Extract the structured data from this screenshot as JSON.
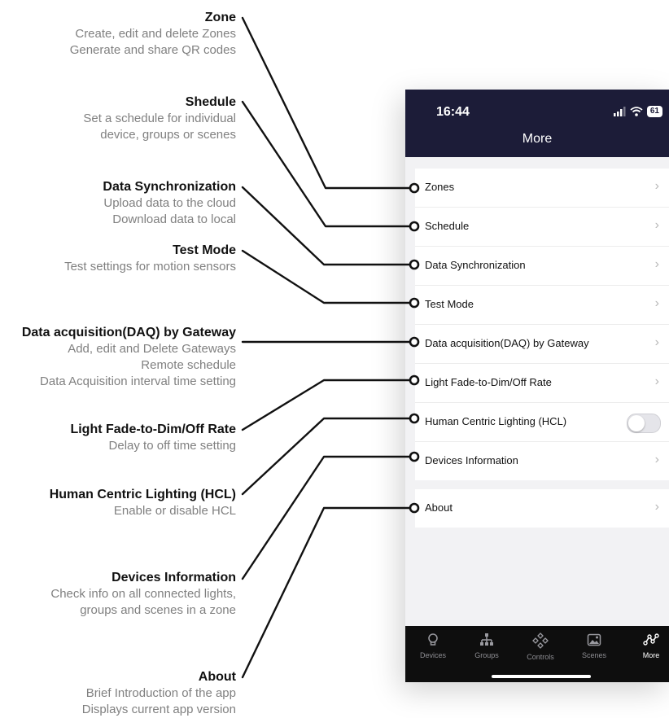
{
  "annotations": [
    {
      "title": "Zone",
      "lines": [
        "Create, edit and delete Zones",
        "Generate and share QR codes"
      ]
    },
    {
      "title": "Shedule",
      "lines": [
        "Set a schedule for individual",
        "device, groups or scenes"
      ]
    },
    {
      "title": "Data Synchronization",
      "lines": [
        "Upload data to the cloud",
        "Download data to local"
      ]
    },
    {
      "title": "Test Mode",
      "lines": [
        "Test settings for motion sensors"
      ]
    },
    {
      "title": "Data acquisition(DAQ) by Gateway",
      "lines": [
        "Add, edit and Delete Gateways",
        "Remote schedule",
        "Data Acquisition interval time setting"
      ]
    },
    {
      "title": "Light Fade-to-Dim/Off Rate",
      "lines": [
        "Delay to off time setting"
      ]
    },
    {
      "title": "Human Centric Lighting (HCL)",
      "lines": [
        "Enable or disable HCL"
      ]
    },
    {
      "title": "Devices Information",
      "lines": [
        "Check info on all connected lights,",
        "groups and scenes in a zone"
      ]
    },
    {
      "title": "About",
      "lines": [
        "Brief Introduction of the app",
        "Displays current app version"
      ]
    }
  ],
  "status_bar": {
    "time": "16:44",
    "battery": "61",
    "icons": [
      "signal-icon",
      "wifi-icon",
      "battery-icon"
    ]
  },
  "header": {
    "title": "More"
  },
  "menu_items": [
    {
      "label": "Zones",
      "control": "chevron"
    },
    {
      "label": "Schedule",
      "control": "chevron"
    },
    {
      "label": "Data Synchronization",
      "control": "chevron"
    },
    {
      "label": "Test Mode",
      "control": "chevron"
    },
    {
      "label": "Data acquisition(DAQ) by Gateway",
      "control": "chevron"
    },
    {
      "label": "Light Fade-to-Dim/Off Rate",
      "control": "chevron"
    },
    {
      "label": "Human Centric Lighting (HCL)",
      "control": "toggle",
      "on": false
    },
    {
      "label": "Devices Information",
      "control": "chevron"
    }
  ],
  "about_item": {
    "label": "About",
    "control": "chevron"
  },
  "chevron": "›",
  "tabs": [
    {
      "label": "Devices",
      "icon": "bulb-icon",
      "active": false
    },
    {
      "label": "Groups",
      "icon": "hierarchy-icon",
      "active": false
    },
    {
      "label": "Controls",
      "icon": "diamond-grid-icon",
      "active": false
    },
    {
      "label": "Scenes",
      "icon": "image-icon",
      "active": false
    },
    {
      "label": "More",
      "icon": "more-nodes-icon",
      "active": true
    }
  ],
  "colors": {
    "header": "#1c1c38",
    "tabbar": "#0e0e0e",
    "annotation_title": "#111111",
    "annotation_desc": "#808080",
    "leader_line": "#111111"
  }
}
